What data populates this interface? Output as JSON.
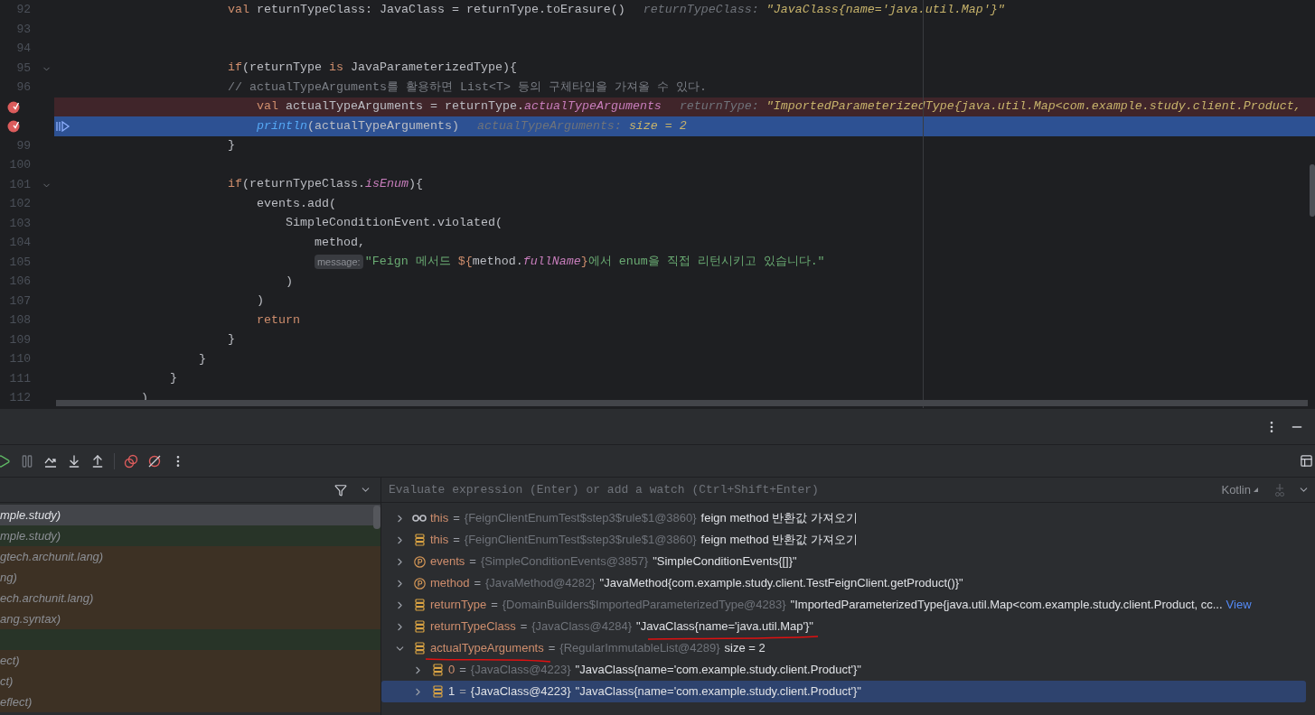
{
  "editor": {
    "lines": [
      {
        "number": "92",
        "code": [
          {
            "kind": "keyword",
            "text": "                        val"
          },
          {
            "kind": "plain",
            "text": " returnTypeClass: JavaClass = returnType.toErasure()"
          }
        ],
        "hint": {
          "label": "returnTypeClass: ",
          "value": "\"JavaClass{name='java.util.Map'}\""
        },
        "breakpoint": false,
        "current": false,
        "fold": false
      },
      {
        "number": "93",
        "breakpoint": false,
        "current": false,
        "fold": false
      },
      {
        "number": "94",
        "breakpoint": false,
        "current": false,
        "fold": false
      },
      {
        "number": "95",
        "code": [
          {
            "kind": "keyword",
            "text": "                        if"
          },
          {
            "kind": "plain",
            "text": "(returnType "
          },
          {
            "kind": "keyword",
            "text": "is"
          },
          {
            "kind": "plain",
            "text": " JavaParameterizedType){"
          }
        ],
        "breakpoint": false,
        "current": false,
        "fold": true
      },
      {
        "number": "96",
        "code": [
          {
            "kind": "comment",
            "text": "                        // actualTypeArguments를 활용하면 List<T> 등의 구체타입을 가져올 수 있다."
          }
        ],
        "breakpoint": false,
        "current": false,
        "fold": false
      },
      {
        "code": [
          {
            "kind": "keyword",
            "text": "                            val"
          },
          {
            "kind": "plain",
            "text": " actualTypeArguments = returnType."
          },
          {
            "kind": "property",
            "text": "actualTypeArguments"
          }
        ],
        "hint": {
          "label": "returnType: ",
          "value": "\"ImportedParameterizedType{java.util.Map<com.example.study.client.Product,"
        },
        "breakpoint": true,
        "current": false,
        "fold": false
      },
      {
        "code": [
          {
            "kind": "function",
            "text": "                            println"
          },
          {
            "kind": "plain",
            "text": "(actualTypeArguments)"
          }
        ],
        "hint": {
          "label": "actualTypeArguments: ",
          "value": "size = 2"
        },
        "breakpoint": true,
        "current": true,
        "fold": false
      },
      {
        "number": "99",
        "code": [
          {
            "kind": "plain",
            "text": "                        }"
          }
        ],
        "breakpoint": false,
        "current": false,
        "fold": false
      },
      {
        "number": "100",
        "breakpoint": false,
        "current": false,
        "fold": false
      },
      {
        "number": "101",
        "code": [
          {
            "kind": "keyword",
            "text": "                        if"
          },
          {
            "kind": "plain",
            "text": "(returnTypeClass."
          },
          {
            "kind": "property",
            "text": "isEnum"
          },
          {
            "kind": "plain",
            "text": "){"
          }
        ],
        "breakpoint": false,
        "current": false,
        "fold": true
      },
      {
        "number": "102",
        "code": [
          {
            "kind": "plain",
            "text": "                            events.add("
          }
        ],
        "breakpoint": false,
        "current": false,
        "fold": false
      },
      {
        "number": "103",
        "code": [
          {
            "kind": "plain",
            "text": "                                SimpleConditionEvent.violated("
          }
        ],
        "breakpoint": false,
        "current": false,
        "fold": false
      },
      {
        "number": "104",
        "code": [
          {
            "kind": "plain",
            "text": "                                    method,"
          }
        ],
        "breakpoint": false,
        "current": false,
        "fold": false
      },
      {
        "number": "105",
        "param_hint": "message:",
        "code": [
          {
            "kind": "string",
            "text": "\"Feign 메서드 "
          },
          {
            "kind": "keyword",
            "text": "${"
          },
          {
            "kind": "plain",
            "text": "method."
          },
          {
            "kind": "property",
            "text": "fullName"
          },
          {
            "kind": "keyword",
            "text": "}"
          },
          {
            "kind": "string",
            "text": "에서 enum을 직접 리턴시키고 있습니다.\""
          }
        ],
        "breakpoint": false,
        "current": false,
        "fold": false
      },
      {
        "number": "106",
        "code": [
          {
            "kind": "plain",
            "text": "                                )"
          }
        ],
        "breakpoint": false,
        "current": false,
        "fold": false
      },
      {
        "number": "107",
        "code": [
          {
            "kind": "plain",
            "text": "                            )"
          }
        ],
        "breakpoint": false,
        "current": false,
        "fold": false
      },
      {
        "number": "108",
        "code": [
          {
            "kind": "keyword",
            "text": "                            return"
          }
        ],
        "breakpoint": false,
        "current": false,
        "fold": false
      },
      {
        "number": "109",
        "code": [
          {
            "kind": "plain",
            "text": "                        }"
          }
        ],
        "breakpoint": false,
        "current": false,
        "fold": false
      },
      {
        "number": "110",
        "code": [
          {
            "kind": "plain",
            "text": "                    }"
          }
        ],
        "breakpoint": false,
        "current": false,
        "fold": false
      },
      {
        "number": "111",
        "code": [
          {
            "kind": "plain",
            "text": "                }"
          }
        ],
        "breakpoint": false,
        "current": false,
        "fold": false
      },
      {
        "number": "112",
        "code": [
          {
            "kind": "plain",
            "text": "            )"
          }
        ],
        "breakpoint": false,
        "current": false,
        "fold": false
      }
    ]
  },
  "frames": [
    {
      "text": "mple.study)",
      "kind": "project",
      "selected": true
    },
    {
      "text": "mple.study)",
      "kind": "project",
      "selected": false
    },
    {
      "text": "gtech.archunit.lang)",
      "kind": "library",
      "selected": false
    },
    {
      "text": "ng)",
      "kind": "library",
      "selected": false
    },
    {
      "text": "ech.archunit.lang)",
      "kind": "library",
      "selected": false
    },
    {
      "text": "ang.syntax)",
      "kind": "library",
      "selected": false
    },
    {
      "kind": "project",
      "selected": false
    },
    {
      "text": "ect)",
      "kind": "library",
      "selected": false
    },
    {
      "text": "ct)",
      "kind": "library",
      "selected": false
    },
    {
      "text": "eflect)",
      "kind": "library",
      "selected": false
    }
  ],
  "evaluate": {
    "placeholder": "Evaluate expression (Enter) or add a watch (Ctrl+Shift+Enter)",
    "language": "Kotlin"
  },
  "variables": [
    {
      "kind": "watch",
      "name": "this",
      "operator": "=",
      "type": "{FeignClientEnumTest$step3$rule$1@3860}",
      "value": "feign method 반환값 가져오기",
      "expanded": false,
      "selected": false,
      "name_underlined": false,
      "value_underlined": false
    },
    {
      "kind": "field",
      "name": "this",
      "operator": "=",
      "type": "{FeignClientEnumTest$step3$rule$1@3860}",
      "value": "feign method 반환값 가져오기",
      "expanded": false,
      "selected": false,
      "name_underlined": false,
      "value_underlined": false
    },
    {
      "kind": "parameter",
      "name": "events",
      "operator": "=",
      "type": "{SimpleConditionEvents@3857}",
      "value": "\"SimpleConditionEvents{[]}\"",
      "expanded": false,
      "selected": false,
      "name_underlined": false,
      "value_underlined": false
    },
    {
      "kind": "parameter",
      "name": "method",
      "operator": "=",
      "type": "{JavaMethod@4282}",
      "value": "\"JavaMethod{com.example.study.client.TestFeignClient.getProduct()}\"",
      "expanded": false,
      "selected": false,
      "name_underlined": false,
      "value_underlined": false
    },
    {
      "kind": "field",
      "name": "returnType",
      "operator": "=",
      "type": "{DomainBuilders$ImportedParameterizedType@4283}",
      "value": "\"ImportedParameterizedType{java.util.Map<com.example.study.client.Product, cc...",
      "link": "View",
      "expanded": false,
      "selected": false,
      "name_underlined": false,
      "value_underlined": false
    },
    {
      "kind": "field",
      "name": "returnTypeClass",
      "operator": "=",
      "type": "{JavaClass@4284}",
      "value": "\"JavaClass{name='java.util.Map'}\"",
      "expanded": false,
      "selected": false,
      "name_underlined": false,
      "value_underlined": true
    },
    {
      "kind": "field",
      "name": "actualTypeArguments",
      "operator": "=",
      "type": "{RegularImmutableList@4289}",
      "value": "size = 2",
      "expanded": true,
      "selected": false,
      "name_underlined": true,
      "value_underlined": false,
      "children": [
        {
          "kind": "field",
          "name": "0",
          "operator": "=",
          "type": "{JavaClass@4223}",
          "value": "\"JavaClass{name='com.example.study.client.Product'}\"",
          "expanded": false,
          "selected": false,
          "name_underlined": false,
          "value_underlined": false
        },
        {
          "kind": "field",
          "name": "1",
          "operator": "=",
          "type": "{JavaClass@4223}",
          "value": "\"JavaClass{name='com.example.study.client.Product'}\"",
          "expanded": false,
          "selected": true,
          "name_underlined": false,
          "value_underlined": false
        }
      ]
    }
  ]
}
